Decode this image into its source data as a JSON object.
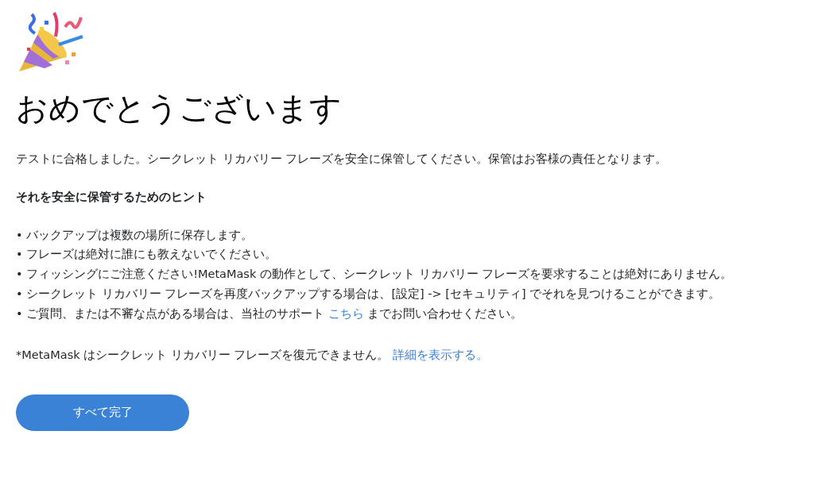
{
  "title": "おめでとうございます",
  "intro": "テストに合格しました。シークレット リカバリー フレーズを安全に保管してください。保管はお客様の責任となります。",
  "tips_heading": "それを安全に保管するためのヒント",
  "tips": [
    [
      {
        "kind": "text",
        "text": "• バックアップは複数の場所に保存します。"
      }
    ],
    [
      {
        "kind": "text",
        "text": "• フレーズは絶対に誰にも教えないでください。"
      }
    ],
    [
      {
        "kind": "text",
        "text": "• フィッシングにご注意ください!MetaMask の動作として、シークレット リカバリー フレーズを要求することは絶対にありません。"
      }
    ],
    [
      {
        "kind": "text",
        "text": "• シークレット リカバリー フレーズを再度バックアップする場合は、[設定] -> [セキュリティ] でそれを見つけることができます。"
      }
    ],
    [
      {
        "kind": "text",
        "text": "• ご質問、または不審な点がある場合は、当社のサポート "
      },
      {
        "kind": "link",
        "text": "こちら"
      },
      {
        "kind": "text",
        "text": " までお問い合わせください。"
      }
    ]
  ],
  "footnote": [
    {
      "kind": "text",
      "text": "*MetaMask はシークレット リカバリー フレーズを復元できません。 "
    },
    {
      "kind": "link",
      "text": "詳細を表示する。"
    }
  ],
  "button": "すべて完了"
}
